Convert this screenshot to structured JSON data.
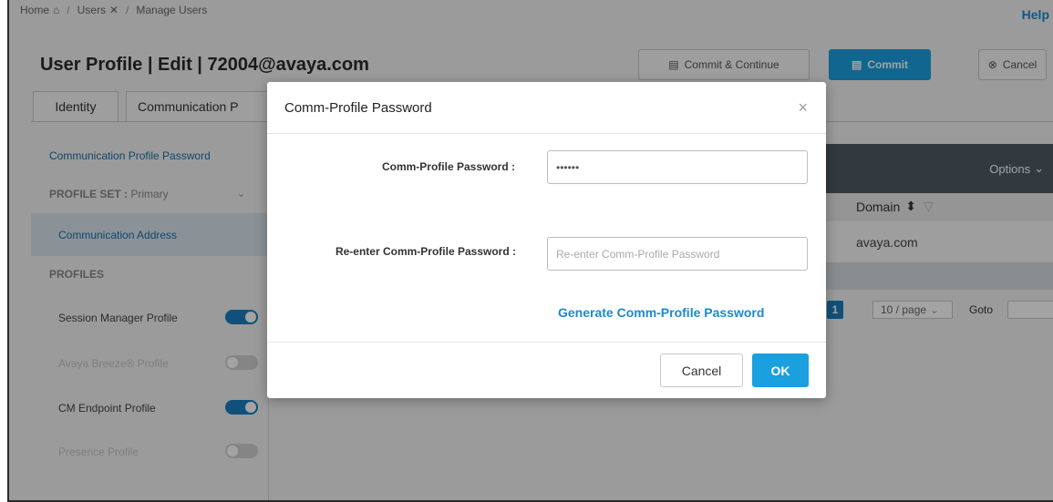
{
  "breadcrumb": {
    "home": "Home",
    "users": "Users",
    "manage": "Manage Users"
  },
  "help": "Help",
  "page_title": "User Profile | Edit | 72004@avaya.com",
  "header_buttons": {
    "commit_continue": "Commit & Continue",
    "commit": "Commit",
    "cancel": "Cancel"
  },
  "tabs": {
    "identity": "Identity",
    "communication": "Communication P"
  },
  "sidebar": {
    "password_link": "Communication Profile Password",
    "profile_set_label": "PROFILE SET :",
    "profile_set_value": " Primary",
    "comm_address": "Communication Address",
    "profiles_heading": "PROFILES",
    "items": [
      {
        "label": "Session Manager Profile",
        "enabled": true
      },
      {
        "label": "Avaya Breeze® Profile",
        "enabled": false
      },
      {
        "label": "CM Endpoint Profile",
        "enabled": true
      },
      {
        "label": "Presence Profile",
        "enabled": false
      }
    ]
  },
  "grid": {
    "options": "Options",
    "domain_header": "Domain",
    "domain_value": "avaya.com",
    "page_number": "1",
    "page_size": "10 / page",
    "goto": "Goto"
  },
  "modal": {
    "title": "Comm-Profile Password",
    "password_label": "Comm-Profile Password :",
    "password_value": "••••••",
    "reenter_label": "Re-enter Comm-Profile Password :",
    "reenter_placeholder": "Re-enter Comm-Profile Password",
    "generate_link": "Generate Comm-Profile Password",
    "cancel": "Cancel",
    "ok": "OK"
  }
}
